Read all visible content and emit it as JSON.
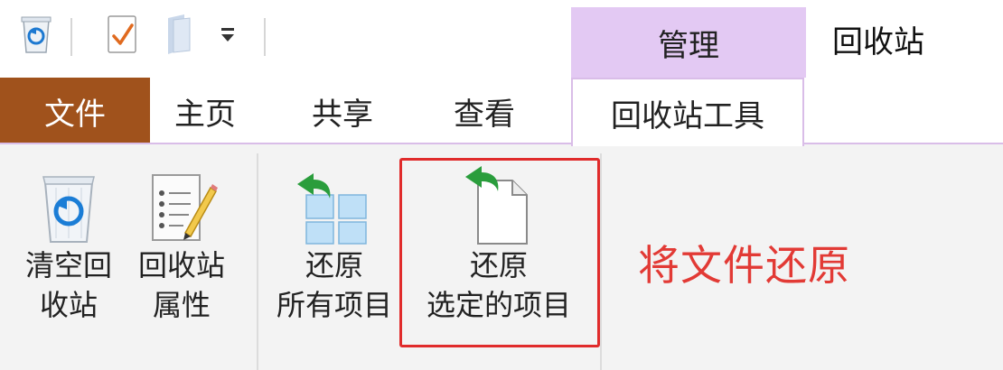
{
  "window": {
    "title": "回收站"
  },
  "quick_access": {
    "icons": [
      "recycle-bin-icon",
      "properties-check-icon",
      "new-folder-icon",
      "customize-dropdown-icon"
    ]
  },
  "context_header": {
    "label": "管理"
  },
  "tabs": [
    {
      "label": "文件",
      "active": false
    },
    {
      "label": "主页",
      "active": false
    },
    {
      "label": "共享",
      "active": false
    },
    {
      "label": "查看",
      "active": false
    },
    {
      "label": "回收站工具",
      "active": true
    }
  ],
  "ribbon": {
    "groups": [
      {
        "buttons": [
          {
            "line1": "清空回",
            "line2": "收站",
            "icon": "empty-recycle-bin-icon"
          },
          {
            "line1": "回收站",
            "line2": "属性",
            "icon": "recycle-bin-properties-icon"
          }
        ]
      },
      {
        "buttons": [
          {
            "line1": "还原",
            "line2": "所有项目",
            "icon": "restore-all-icon"
          },
          {
            "line1": "还原",
            "line2": "选定的项目",
            "icon": "restore-selected-icon"
          }
        ]
      }
    ]
  },
  "annotation": {
    "text": "将文件还原",
    "color": "#e23a35"
  },
  "colors": {
    "file_tab": "#a0521c",
    "context_tab": "#e3c9f3",
    "highlight_box": "#e02b2b"
  }
}
